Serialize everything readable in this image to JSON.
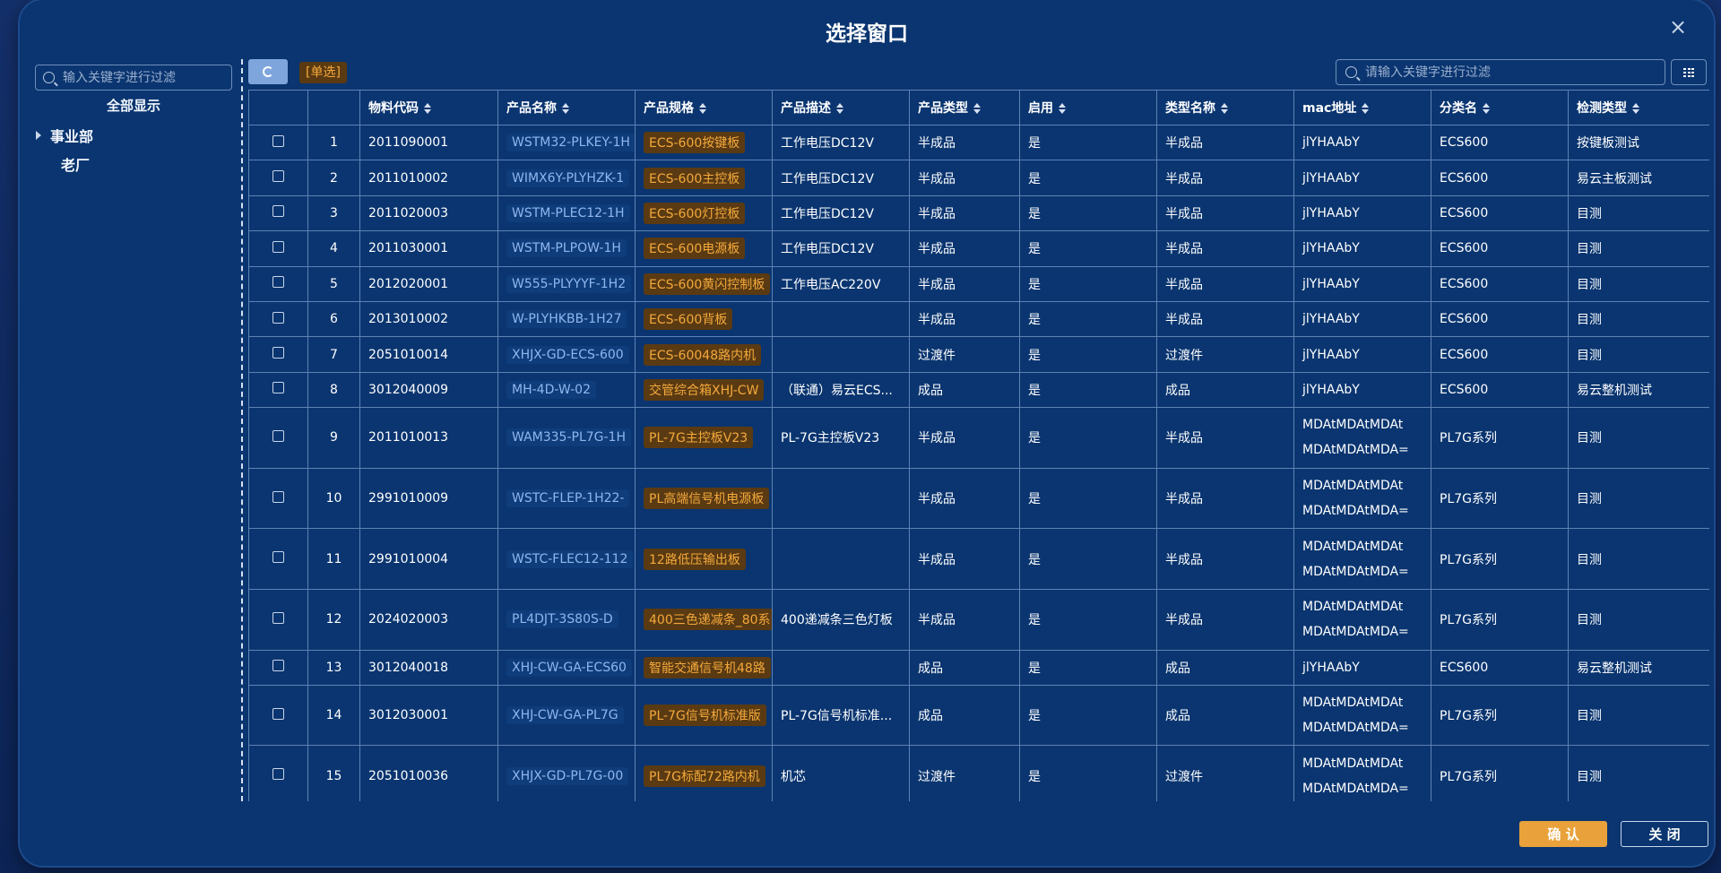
{
  "dialog": {
    "title": "选择窗口",
    "close_glyph": "×"
  },
  "tree": {
    "search_placeholder": "输入关键字进行过滤",
    "show_all": "全部显示",
    "nodes": [
      {
        "label": "事业部",
        "expandable": true
      },
      {
        "label": "老厂",
        "expandable": false
      }
    ]
  },
  "toolbar": {
    "single_select_tag": "[单选]",
    "search_placeholder": "请输入关键字进行过滤"
  },
  "table": {
    "columns": [
      "物料代码",
      "产品名称",
      "产品规格",
      "产品描述",
      "产品类型",
      "启用",
      "类型名称",
      "mac地址",
      "分类名",
      "检测类型"
    ],
    "rows": [
      {
        "idx": "1",
        "code": "2011090001",
        "name": "WSTM32-PLKEY-1H",
        "spec": "ECS-600按键板",
        "desc": "工作电压DC12V",
        "ptype": "半成品",
        "enabled": "是",
        "tname": "半成品",
        "mac": [
          "jlYHAAbY"
        ],
        "cat": "ECS600",
        "check": "按键板测试"
      },
      {
        "idx": "2",
        "code": "2011010002",
        "name": "WIMX6Y-PLYHZK-1",
        "spec": "ECS-600主控板",
        "desc": "工作电压DC12V",
        "ptype": "半成品",
        "enabled": "是",
        "tname": "半成品",
        "mac": [
          "jlYHAAbY"
        ],
        "cat": "ECS600",
        "check": "易云主板测试"
      },
      {
        "idx": "3",
        "code": "2011020003",
        "name": "WSTM-PLEC12-1H",
        "spec": "ECS-600灯控板",
        "desc": "工作电压DC12V",
        "ptype": "半成品",
        "enabled": "是",
        "tname": "半成品",
        "mac": [
          "jlYHAAbY"
        ],
        "cat": "ECS600",
        "check": "目测"
      },
      {
        "idx": "4",
        "code": "2011030001",
        "name": "WSTM-PLPOW-1H",
        "spec": "ECS-600电源板",
        "desc": "工作电压DC12V",
        "ptype": "半成品",
        "enabled": "是",
        "tname": "半成品",
        "mac": [
          "jlYHAAbY"
        ],
        "cat": "ECS600",
        "check": "目测"
      },
      {
        "idx": "5",
        "code": "2012020001",
        "name": "W555-PLYYYF-1H2",
        "spec": "ECS-600黄闪控制板",
        "desc": "工作电压AC220V",
        "ptype": "半成品",
        "enabled": "是",
        "tname": "半成品",
        "mac": [
          "jlYHAAbY"
        ],
        "cat": "ECS600",
        "check": "目测"
      },
      {
        "idx": "6",
        "code": "2013010002",
        "name": "W-PLYHKBB-1H27",
        "spec": "ECS-600背板",
        "desc": "",
        "ptype": "半成品",
        "enabled": "是",
        "tname": "半成品",
        "mac": [
          "jlYHAAbY"
        ],
        "cat": "ECS600",
        "check": "目测"
      },
      {
        "idx": "7",
        "code": "2051010014",
        "name": "XHJX-GD-ECS-600",
        "spec": "ECS-60048路内机",
        "desc": "",
        "ptype": "过渡件",
        "enabled": "是",
        "tname": "过渡件",
        "mac": [
          "jlYHAAbY"
        ],
        "cat": "ECS600",
        "check": "目测"
      },
      {
        "idx": "8",
        "code": "3012040009",
        "name": "MH-4D-W-02",
        "spec": "交管综合箱XHJ-CW",
        "desc": "（联通）易云ECS...",
        "ptype": "成品",
        "enabled": "是",
        "tname": "成品",
        "mac": [
          "jlYHAAbY"
        ],
        "cat": "ECS600",
        "check": "易云整机测试"
      },
      {
        "idx": "9",
        "code": "2011010013",
        "name": "WAM335-PL7G-1H",
        "spec": "PL-7G主控板V23",
        "desc": "PL-7G主控板V23",
        "ptype": "半成品",
        "enabled": "是",
        "tname": "半成品",
        "mac": [
          "MDAtMDAtMDAt",
          "MDAtMDAtMDA="
        ],
        "cat": "PL7G系列",
        "check": "目测"
      },
      {
        "idx": "10",
        "code": "2991010009",
        "name": "WSTC-FLEP-1H22-",
        "spec": "PL高端信号机电源板",
        "desc": "",
        "ptype": "半成品",
        "enabled": "是",
        "tname": "半成品",
        "mac": [
          "MDAtMDAtMDAt",
          "MDAtMDAtMDA="
        ],
        "cat": "PL7G系列",
        "check": "目测"
      },
      {
        "idx": "11",
        "code": "2991010004",
        "name": "WSTC-FLEC12-112",
        "spec": "12路低压输出板",
        "desc": "",
        "ptype": "半成品",
        "enabled": "是",
        "tname": "半成品",
        "mac": [
          "MDAtMDAtMDAt",
          "MDAtMDAtMDA="
        ],
        "cat": "PL7G系列",
        "check": "目测"
      },
      {
        "idx": "12",
        "code": "2024020003",
        "name": "PL4DJT-3S80S-D",
        "spec": "400三色递减条_80系",
        "desc": "400递减条三色灯板",
        "ptype": "半成品",
        "enabled": "是",
        "tname": "半成品",
        "mac": [
          "MDAtMDAtMDAt",
          "MDAtMDAtMDA="
        ],
        "cat": "PL7G系列",
        "check": "目测"
      },
      {
        "idx": "13",
        "code": "3012040018",
        "name": "XHJ-CW-GA-ECS60",
        "spec": "智能交通信号机48路",
        "desc": "",
        "ptype": "成品",
        "enabled": "是",
        "tname": "成品",
        "mac": [
          "jlYHAAbY"
        ],
        "cat": "ECS600",
        "check": "易云整机测试"
      },
      {
        "idx": "14",
        "code": "3012030001",
        "name": "XHJ-CW-GA-PL7G",
        "spec": "PL-7G信号机标准版",
        "desc": "PL-7G信号机标准...",
        "ptype": "成品",
        "enabled": "是",
        "tname": "成品",
        "mac": [
          "MDAtMDAtMDAt",
          "MDAtMDAtMDA="
        ],
        "cat": "PL7G系列",
        "check": "目测"
      },
      {
        "idx": "15",
        "code": "2051010036",
        "name": "XHJX-GD-PL7G-00",
        "spec": "PL7G标配72路内机",
        "desc": "机芯",
        "ptype": "过渡件",
        "enabled": "是",
        "tname": "过渡件",
        "mac": [
          "MDAtMDAtMDAt",
          "MDAtMDAtMDA="
        ],
        "cat": "PL7G系列",
        "check": "目测"
      }
    ]
  },
  "footer": {
    "confirm_label": "确 认",
    "close_label": "关 闭"
  },
  "icons": {
    "search": "search-icon",
    "refresh": "refresh-icon",
    "grid": "grid-icon",
    "caret": "caret-right-icon",
    "sort": "sort-icon"
  },
  "colors": {
    "modal_bg": "#0a3570",
    "accent_orange": "#e9a23b",
    "spec_text": "#f4a93b",
    "name_text": "#8fb7ef"
  }
}
